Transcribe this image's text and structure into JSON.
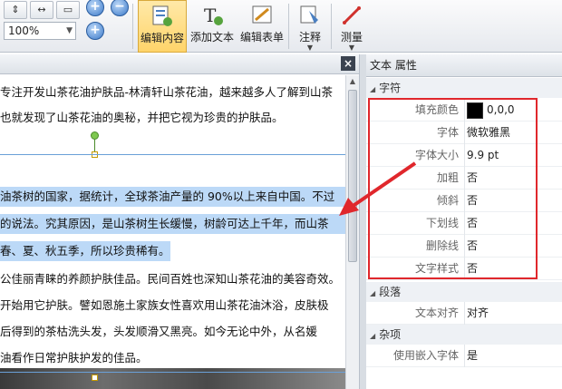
{
  "toolbar": {
    "zoom_value": "100%",
    "tools": [
      {
        "label": "编辑内容",
        "icon": "edit-content-icon",
        "active": true
      },
      {
        "label": "添加文本",
        "icon": "add-text-icon",
        "active": false
      },
      {
        "label": "编辑表单",
        "icon": "edit-form-icon",
        "active": false
      },
      {
        "label": "注释",
        "icon": "annotation-icon",
        "active": false
      },
      {
        "label": "测量",
        "icon": "measure-icon",
        "active": false
      }
    ]
  },
  "document": {
    "close_label": "×",
    "lines": [
      {
        "text": "专注开发山茶花油护肤品-林清轩山茶花油，越来越多人了解到山茶",
        "highlight": false
      },
      {
        "text": "也就发现了山茶花油的奥秘，并把它视为珍贵的护肤品。",
        "highlight": false
      },
      {
        "text": "油茶树的国家，据统计，全球茶油产量的 90%以上来自中国。不过",
        "highlight": true
      },
      {
        "text": "的说法。究其原因，是山茶树生长缓慢，树龄可达上千年，而山茶",
        "highlight": true
      },
      {
        "text": "春、夏、秋五季，所以珍贵稀有。",
        "highlight": true
      },
      {
        "text": "公佳丽青睐的养颜护肤佳品。民间百姓也深知山茶花油的美容奇效。",
        "highlight": false
      },
      {
        "text": "开始用它护肤。譬如恩施土家族女性喜欢用山茶花油沐浴，皮肤极",
        "highlight": false
      },
      {
        "text": "后得到的茶枯洗头发，头发顺滑又黑亮。如今无论中外，从名媛",
        "highlight": false
      },
      {
        "text": "油看作日常护肤护发的佳品。",
        "highlight": false
      }
    ]
  },
  "properties": {
    "title": "文本 属性",
    "sections": {
      "char": "字符",
      "para": "段落",
      "misc": "杂项"
    },
    "char_rows": [
      {
        "key": "填充颜色",
        "value": "0,0,0",
        "swatch": "#000000"
      },
      {
        "key": "字体",
        "value": "微软雅黑"
      },
      {
        "key": "字体大小",
        "value": "9.9 pt"
      },
      {
        "key": "加粗",
        "value": "否"
      },
      {
        "key": "倾斜",
        "value": "否"
      },
      {
        "key": "下划线",
        "value": "否"
      },
      {
        "key": "删除线",
        "value": "否"
      },
      {
        "key": "文字样式",
        "value": "否"
      }
    ],
    "para_rows": [
      {
        "key": "文本对齐",
        "value": "对齐"
      }
    ],
    "misc_rows": [
      {
        "key": "使用嵌入字体",
        "value": "是"
      }
    ]
  },
  "colors": {
    "highlight": "#bcd9f7",
    "callout": "#e0272c",
    "active_tool": "#ffd46a"
  }
}
